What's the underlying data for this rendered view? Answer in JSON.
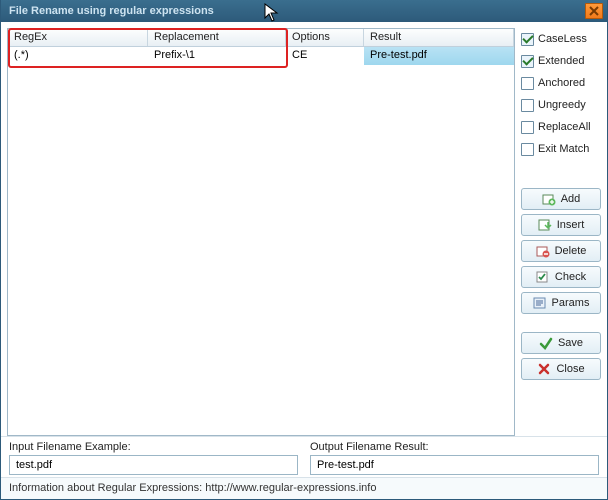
{
  "title": "File Rename using regular expressions",
  "grid": {
    "headers": {
      "regex": "RegEx",
      "replacement": "Replacement",
      "options": "Options",
      "result": "Result"
    },
    "row": {
      "regex": "(.*)",
      "replacement": "Prefix-\\1",
      "options": "CE",
      "result": "Pre-test.pdf"
    }
  },
  "checks": {
    "caseless": "CaseLess",
    "extended": "Extended",
    "anchored": "Anchored",
    "ungreedy": "Ungreedy",
    "replaceall": "ReplaceAll",
    "exitmatch": "Exit Match"
  },
  "buttons": {
    "add": "Add",
    "insert": "Insert",
    "delete": "Delete",
    "check": "Check",
    "params": "Params",
    "save": "Save",
    "close": "Close"
  },
  "io": {
    "input_label": "Input Filename Example:",
    "input_value": "test.pdf",
    "output_label": "Output Filename Result:",
    "output_value": "Pre-test.pdf"
  },
  "status": "Information about Regular Expressions: http://www.regular-expressions.info"
}
